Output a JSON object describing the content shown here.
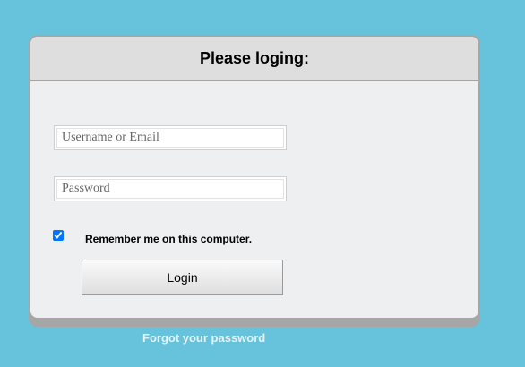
{
  "login_panel": {
    "title": "Please loging:",
    "username_placeholder": "Username or Email",
    "username_value": "",
    "password_placeholder": "Password",
    "password_value": "",
    "remember_checked": true,
    "remember_label": "Remember me on this computer.",
    "login_button_label": "Login"
  },
  "forgot_password_link": "Forgot your password",
  "colors": {
    "background": "#66c3db",
    "panel_body": "#eeeff1",
    "panel_header": "#dededf",
    "panel_border": "#a6a6a6",
    "link_text": "#e6f2f6"
  }
}
